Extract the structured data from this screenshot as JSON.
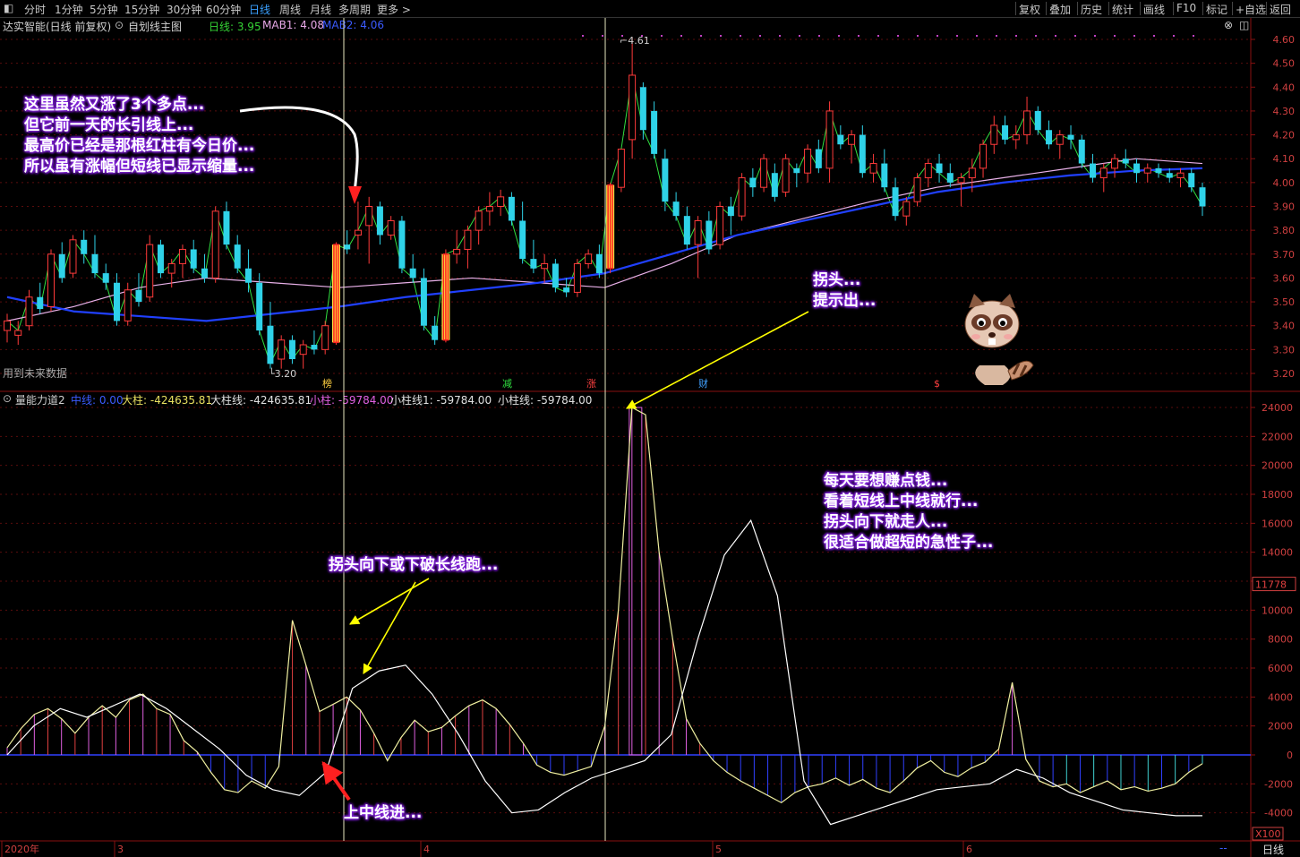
{
  "toolbar": {
    "periods": [
      "分时",
      "1分钟",
      "5分钟",
      "15分钟",
      "30分钟",
      "60分钟",
      "日线",
      "周线",
      "月线",
      "多周期",
      "更多 >"
    ],
    "active_period": "日线",
    "right_buttons": [
      "复权",
      "叠加",
      "历史",
      "统计",
      "画线",
      "F10",
      "标记",
      "+自选",
      "返回"
    ]
  },
  "main_info": {
    "stock": "达实智能(日线 前复权)",
    "template": "自划线主图",
    "day_line_label": "日线: 3.95",
    "mab1_label": "MAB1: 4.08",
    "mab2_label": "MAB2: 4.06",
    "future_data_note": "用到未来数据"
  },
  "indicator_info": {
    "name": "量能力道2",
    "mid_line": "中线: 0.00",
    "big_bar": "大柱: -424635.81",
    "big_bar_line": "大柱线: -424635.81",
    "small_bar": "小柱: -59784.00",
    "small_bar_line1": "小柱线1: -59784.00",
    "small_bar_line": "小柱线: -59784.00",
    "current_value_tag": "11778",
    "multiplier_tag": "X100"
  },
  "annotations": {
    "top_left": [
      "这里虽然又涨了3个多点...",
      "但它前一天的长引线上...",
      "最高价已经是那根红柱有今日价...",
      "所以虽有涨幅但短线已显示缩量..."
    ],
    "turn_hint": [
      "拐头...",
      "提示出..."
    ],
    "right_text": [
      "每天要想赚点钱...",
      "看着短线上中线就行...",
      "拐头向下就走人...",
      "很适合做超短的急性子..."
    ],
    "break_text": "拐头向下或下破长线跑...",
    "entry_text": "上中线进..."
  },
  "event_markers": [
    "榜",
    "减",
    "涨",
    "财",
    "$"
  ],
  "time_axis": {
    "labels": [
      "2020年",
      "3",
      "4",
      "5",
      "6"
    ],
    "right_label": "日线",
    "right_dash": "--"
  },
  "chart_data": [
    {
      "type": "candlestick",
      "title": "达实智能(日线 前复权)",
      "ylim": [
        3.15,
        4.65
      ],
      "y_ticks": [
        3.2,
        3.3,
        3.4,
        3.5,
        3.6,
        3.7,
        3.8,
        3.9,
        4.0,
        4.1,
        4.2,
        4.3,
        4.4,
        4.5,
        4.6
      ],
      "high_label": "4.61",
      "low_label": "3.20",
      "candles": [
        {
          "o": 3.38,
          "h": 3.45,
          "l": 3.33,
          "c": 3.42
        },
        {
          "o": 3.36,
          "h": 3.42,
          "l": 3.32,
          "c": 3.38
        },
        {
          "o": 3.4,
          "h": 3.55,
          "l": 3.38,
          "c": 3.52
        },
        {
          "o": 3.52,
          "h": 3.58,
          "l": 3.45,
          "c": 3.47
        },
        {
          "o": 3.48,
          "h": 3.72,
          "l": 3.46,
          "c": 3.7
        },
        {
          "o": 3.7,
          "h": 3.75,
          "l": 3.58,
          "c": 3.6
        },
        {
          "o": 3.62,
          "h": 3.78,
          "l": 3.6,
          "c": 3.76
        },
        {
          "o": 3.76,
          "h": 3.8,
          "l": 3.66,
          "c": 3.7
        },
        {
          "o": 3.7,
          "h": 3.78,
          "l": 3.6,
          "c": 3.62
        },
        {
          "o": 3.62,
          "h": 3.66,
          "l": 3.55,
          "c": 3.58
        },
        {
          "o": 3.58,
          "h": 3.62,
          "l": 3.4,
          "c": 3.42
        },
        {
          "o": 3.42,
          "h": 3.58,
          "l": 3.4,
          "c": 3.55
        },
        {
          "o": 3.55,
          "h": 3.62,
          "l": 3.48,
          "c": 3.5
        },
        {
          "o": 3.52,
          "h": 3.78,
          "l": 3.5,
          "c": 3.74
        },
        {
          "o": 3.74,
          "h": 3.76,
          "l": 3.6,
          "c": 3.62
        },
        {
          "o": 3.62,
          "h": 3.68,
          "l": 3.56,
          "c": 3.66
        },
        {
          "o": 3.66,
          "h": 3.74,
          "l": 3.6,
          "c": 3.72
        },
        {
          "o": 3.72,
          "h": 3.76,
          "l": 3.62,
          "c": 3.64
        },
        {
          "o": 3.64,
          "h": 3.7,
          "l": 3.58,
          "c": 3.6
        },
        {
          "o": 3.6,
          "h": 3.9,
          "l": 3.58,
          "c": 3.88
        },
        {
          "o": 3.88,
          "h": 3.92,
          "l": 3.72,
          "c": 3.74
        },
        {
          "o": 3.74,
          "h": 3.78,
          "l": 3.62,
          "c": 3.64
        },
        {
          "o": 3.64,
          "h": 3.72,
          "l": 3.54,
          "c": 3.58
        },
        {
          "o": 3.58,
          "h": 3.62,
          "l": 3.36,
          "c": 3.38
        },
        {
          "o": 3.4,
          "h": 3.5,
          "l": 3.22,
          "c": 3.24
        },
        {
          "o": 3.26,
          "h": 3.36,
          "l": 3.22,
          "c": 3.34
        },
        {
          "o": 3.34,
          "h": 3.36,
          "l": 3.24,
          "c": 3.26
        },
        {
          "o": 3.28,
          "h": 3.34,
          "l": 3.22,
          "c": 3.32
        },
        {
          "o": 3.32,
          "h": 3.38,
          "l": 3.28,
          "c": 3.3
        },
        {
          "o": 3.3,
          "h": 3.42,
          "l": 3.28,
          "c": 3.4
        },
        {
          "o": 3.33,
          "h": 3.75,
          "l": 3.32,
          "c": 3.74
        },
        {
          "o": 3.74,
          "h": 3.8,
          "l": 3.7,
          "c": 3.72
        },
        {
          "o": 3.78,
          "h": 3.92,
          "l": 3.72,
          "c": 3.8
        },
        {
          "o": 3.82,
          "h": 3.94,
          "l": 3.66,
          "c": 3.9
        },
        {
          "o": 3.9,
          "h": 3.92,
          "l": 3.74,
          "c": 3.78
        },
        {
          "o": 3.78,
          "h": 3.86,
          "l": 3.76,
          "c": 3.84
        },
        {
          "o": 3.84,
          "h": 3.86,
          "l": 3.62,
          "c": 3.64
        },
        {
          "o": 3.64,
          "h": 3.7,
          "l": 3.58,
          "c": 3.6
        },
        {
          "o": 3.6,
          "h": 3.64,
          "l": 3.38,
          "c": 3.4
        },
        {
          "o": 3.4,
          "h": 3.44,
          "l": 3.32,
          "c": 3.34
        },
        {
          "o": 3.34,
          "h": 3.72,
          "l": 3.33,
          "c": 3.7
        },
        {
          "o": 3.7,
          "h": 3.8,
          "l": 3.66,
          "c": 3.72
        },
        {
          "o": 3.72,
          "h": 3.82,
          "l": 3.64,
          "c": 3.8
        },
        {
          "o": 3.8,
          "h": 3.9,
          "l": 3.74,
          "c": 3.88
        },
        {
          "o": 3.88,
          "h": 3.96,
          "l": 3.82,
          "c": 3.9
        },
        {
          "o": 3.9,
          "h": 3.97,
          "l": 3.86,
          "c": 3.94
        },
        {
          "o": 3.94,
          "h": 3.96,
          "l": 3.82,
          "c": 3.84
        },
        {
          "o": 3.84,
          "h": 3.92,
          "l": 3.66,
          "c": 3.68
        },
        {
          "o": 3.68,
          "h": 3.76,
          "l": 3.62,
          "c": 3.64
        },
        {
          "o": 3.64,
          "h": 3.7,
          "l": 3.58,
          "c": 3.66
        },
        {
          "o": 3.66,
          "h": 3.68,
          "l": 3.54,
          "c": 3.56
        },
        {
          "o": 3.56,
          "h": 3.6,
          "l": 3.52,
          "c": 3.54
        },
        {
          "o": 3.54,
          "h": 3.68,
          "l": 3.52,
          "c": 3.66
        },
        {
          "o": 3.66,
          "h": 3.72,
          "l": 3.64,
          "c": 3.7
        },
        {
          "o": 3.7,
          "h": 3.74,
          "l": 3.6,
          "c": 3.62
        },
        {
          "o": 3.64,
          "h": 4.0,
          "l": 3.62,
          "c": 3.99
        },
        {
          "o": 3.98,
          "h": 4.14,
          "l": 3.96,
          "c": 4.14
        },
        {
          "o": 4.18,
          "h": 4.61,
          "l": 4.1,
          "c": 4.45
        },
        {
          "o": 4.4,
          "h": 4.42,
          "l": 4.18,
          "c": 4.22
        },
        {
          "o": 4.3,
          "h": 4.34,
          "l": 4.1,
          "c": 4.12
        },
        {
          "o": 4.1,
          "h": 4.14,
          "l": 3.88,
          "c": 3.92
        },
        {
          "o": 3.92,
          "h": 3.96,
          "l": 3.84,
          "c": 3.86
        },
        {
          "o": 3.86,
          "h": 3.9,
          "l": 3.72,
          "c": 3.74
        },
        {
          "o": 3.74,
          "h": 3.86,
          "l": 3.6,
          "c": 3.84
        },
        {
          "o": 3.84,
          "h": 3.88,
          "l": 3.7,
          "c": 3.72
        },
        {
          "o": 3.74,
          "h": 3.92,
          "l": 3.72,
          "c": 3.9
        },
        {
          "o": 3.9,
          "h": 3.94,
          "l": 3.78,
          "c": 3.86
        },
        {
          "o": 3.86,
          "h": 4.04,
          "l": 3.84,
          "c": 4.02
        },
        {
          "o": 4.02,
          "h": 4.06,
          "l": 3.94,
          "c": 3.98
        },
        {
          "o": 3.98,
          "h": 4.12,
          "l": 3.96,
          "c": 4.1
        },
        {
          "o": 4.04,
          "h": 4.08,
          "l": 3.92,
          "c": 3.94
        },
        {
          "o": 3.96,
          "h": 4.12,
          "l": 3.94,
          "c": 4.1
        },
        {
          "o": 4.06,
          "h": 4.08,
          "l": 3.98,
          "c": 4.04
        },
        {
          "o": 4.04,
          "h": 4.16,
          "l": 4.0,
          "c": 4.14
        },
        {
          "o": 4.14,
          "h": 4.18,
          "l": 4.04,
          "c": 4.06
        },
        {
          "o": 4.06,
          "h": 4.34,
          "l": 4.0,
          "c": 4.3
        },
        {
          "o": 4.2,
          "h": 4.24,
          "l": 4.14,
          "c": 4.16
        },
        {
          "o": 4.16,
          "h": 4.22,
          "l": 4.08,
          "c": 4.2
        },
        {
          "o": 4.2,
          "h": 4.24,
          "l": 4.02,
          "c": 4.04
        },
        {
          "o": 4.04,
          "h": 4.12,
          "l": 4.0,
          "c": 4.08
        },
        {
          "o": 4.08,
          "h": 4.14,
          "l": 3.96,
          "c": 3.98
        },
        {
          "o": 3.98,
          "h": 4.02,
          "l": 3.84,
          "c": 3.86
        },
        {
          "o": 3.86,
          "h": 3.94,
          "l": 3.82,
          "c": 3.92
        },
        {
          "o": 3.92,
          "h": 4.04,
          "l": 3.9,
          "c": 4.02
        },
        {
          "o": 4.02,
          "h": 4.1,
          "l": 3.98,
          "c": 4.08
        },
        {
          "o": 4.08,
          "h": 4.12,
          "l": 4.0,
          "c": 4.04
        },
        {
          "o": 4.04,
          "h": 4.08,
          "l": 3.98,
          "c": 4.0
        },
        {
          "o": 4.0,
          "h": 4.04,
          "l": 3.9,
          "c": 4.02
        },
        {
          "o": 4.02,
          "h": 4.1,
          "l": 3.96,
          "c": 4.06
        },
        {
          "o": 4.06,
          "h": 4.18,
          "l": 4.02,
          "c": 4.16
        },
        {
          "o": 4.16,
          "h": 4.28,
          "l": 4.12,
          "c": 4.24
        },
        {
          "o": 4.24,
          "h": 4.28,
          "l": 4.16,
          "c": 4.18
        },
        {
          "o": 4.18,
          "h": 4.24,
          "l": 4.14,
          "c": 4.2
        },
        {
          "o": 4.2,
          "h": 4.36,
          "l": 4.16,
          "c": 4.3
        },
        {
          "o": 4.3,
          "h": 4.32,
          "l": 4.2,
          "c": 4.22
        },
        {
          "o": 4.22,
          "h": 4.26,
          "l": 4.14,
          "c": 4.16
        },
        {
          "o": 4.16,
          "h": 4.22,
          "l": 4.1,
          "c": 4.2
        },
        {
          "o": 4.2,
          "h": 4.24,
          "l": 4.14,
          "c": 4.18
        },
        {
          "o": 4.18,
          "h": 4.2,
          "l": 4.06,
          "c": 4.08
        },
        {
          "o": 4.08,
          "h": 4.12,
          "l": 4.0,
          "c": 4.02
        },
        {
          "o": 4.02,
          "h": 4.08,
          "l": 3.96,
          "c": 4.06
        },
        {
          "o": 4.06,
          "h": 4.12,
          "l": 4.02,
          "c": 4.1
        },
        {
          "o": 4.1,
          "h": 4.14,
          "l": 4.06,
          "c": 4.08
        },
        {
          "o": 4.08,
          "h": 4.1,
          "l": 4.0,
          "c": 4.04
        },
        {
          "o": 4.04,
          "h": 4.08,
          "l": 4.0,
          "c": 4.06
        },
        {
          "o": 4.06,
          "h": 4.08,
          "l": 4.02,
          "c": 4.04
        },
        {
          "o": 4.04,
          "h": 4.06,
          "l": 4.0,
          "c": 4.02
        },
        {
          "o": 4.02,
          "h": 4.06,
          "l": 3.98,
          "c": 4.04
        },
        {
          "o": 4.04,
          "h": 4.06,
          "l": 3.96,
          "c": 3.98
        },
        {
          "o": 3.98,
          "h": 4.0,
          "l": 3.86,
          "c": 3.9
        }
      ],
      "ma_long_levels": [
        3.52,
        3.46,
        3.44,
        3.42,
        3.45,
        3.48,
        3.52,
        3.55,
        3.58,
        3.62,
        3.7,
        3.78,
        3.84,
        3.9,
        3.96,
        4.0,
        4.03,
        4.05,
        4.06
      ],
      "ma_mid_levels": [
        3.42,
        3.48,
        3.56,
        3.6,
        3.58,
        3.56,
        3.58,
        3.6,
        3.58,
        3.56,
        3.66,
        3.78,
        3.85,
        3.92,
        3.98,
        4.02,
        4.06,
        4.1,
        4.08
      ]
    },
    {
      "type": "bar",
      "title": "量能力道2",
      "ylim": [
        -5000,
        25000
      ],
      "y_ticks": [
        -4000,
        -2000,
        0,
        2000,
        4000,
        6000,
        8000,
        10000,
        12000,
        14000,
        16000,
        18000,
        20000,
        22000,
        24000
      ],
      "values": [
        500,
        1800,
        2800,
        3200,
        2500,
        1500,
        2600,
        3400,
        2600,
        3800,
        4200,
        3200,
        2800,
        1000,
        200,
        -1200,
        -2400,
        -2600,
        -1800,
        -2300,
        -800,
        9300,
        6200,
        3000,
        3500,
        4000,
        3100,
        1500,
        -400,
        1200,
        2400,
        1600,
        1900,
        2700,
        3400,
        3800,
        3200,
        2100,
        800,
        -700,
        -1200,
        -1400,
        -1100,
        -800,
        2000,
        10000,
        24000,
        23500,
        14000,
        8000,
        2500,
        800,
        -400,
        -1200,
        -1800,
        -2300,
        -2800,
        -3300,
        -2600,
        -2200,
        -2000,
        -1600,
        -2100,
        -1700,
        -2300,
        -2600,
        -1800,
        -900,
        -400,
        -1200,
        -1500,
        -900,
        -500,
        400,
        5000,
        -300,
        -1800,
        -2200,
        -2000,
        -2600,
        -2200,
        -1800,
        -2400,
        -2200,
        -2500,
        -2300,
        -2000,
        -1200,
        -600
      ],
      "mid_line_levels": [
        0,
        2000,
        3200,
        2600,
        3400,
        4200,
        3200,
        1800,
        400,
        -1400,
        -2400,
        -2800,
        -1200,
        4600,
        5800,
        6200,
        4200,
        1400,
        -1800,
        -4000,
        -3800,
        -2600,
        -1600,
        -1000,
        -400,
        1400,
        8000,
        13800,
        16200,
        11000,
        -1800,
        -4800,
        -4200,
        -3600,
        -3000,
        -2400,
        -2200,
        -2000,
        -1000,
        -1600,
        -2600,
        -3200,
        -3800,
        -4000,
        -4200,
        -4200
      ]
    }
  ]
}
